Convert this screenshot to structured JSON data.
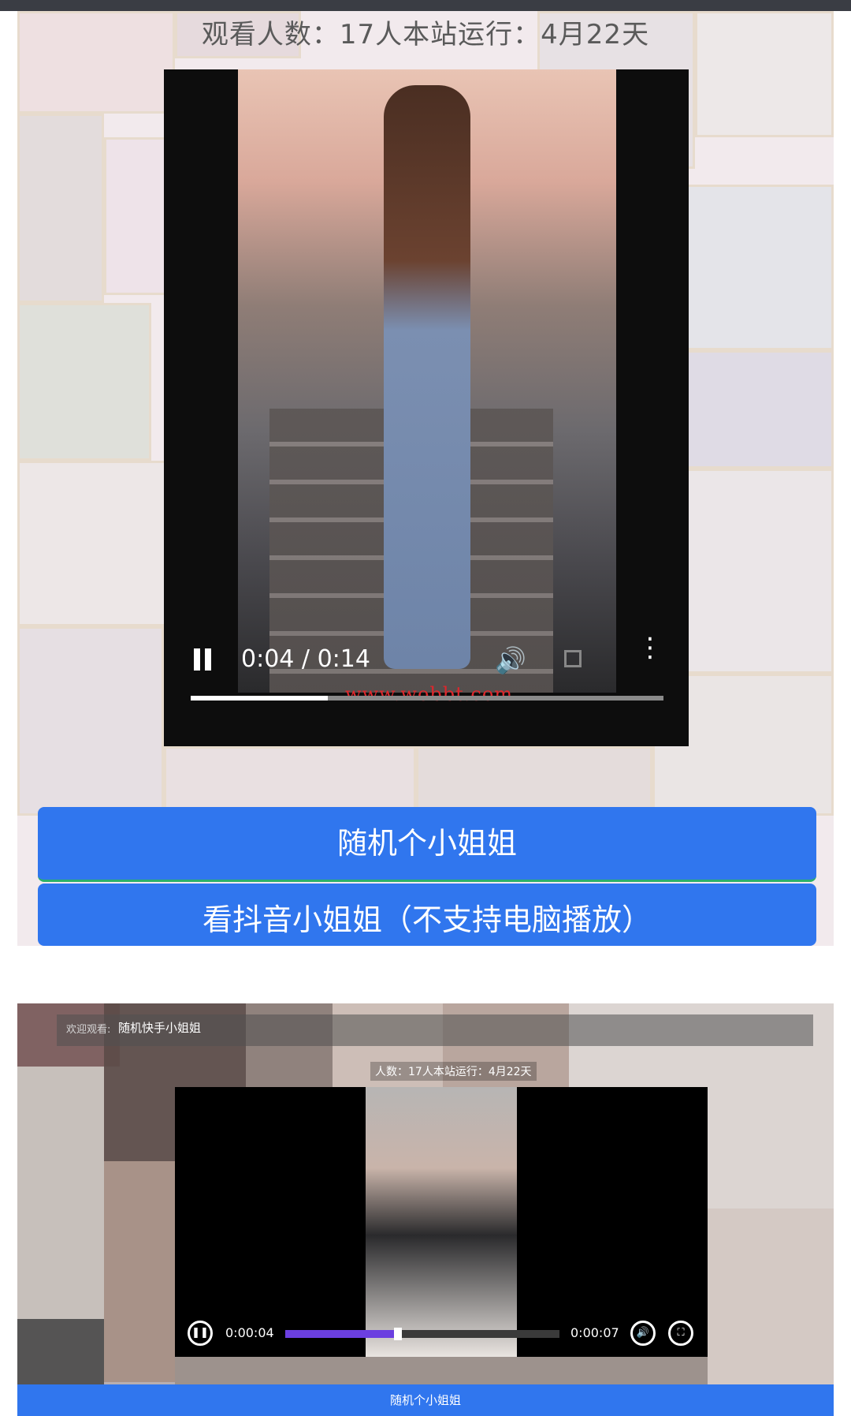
{
  "screen1": {
    "stats": "观看人数：17人本站运行：4月22天",
    "video": {
      "current_time": "0:04",
      "separator": " / ",
      "duration": "0:14",
      "progress": 0.29,
      "watermark": "www.wobbt.com",
      "pause_icon": "pause-icon",
      "volume_icon": "volume-icon",
      "fullscreen_icon": "fullscreen-icon",
      "more_icon": "more-vertical-icon"
    },
    "buttons": [
      {
        "label": "随机个小姐姐"
      },
      {
        "label": "看抖音小姐姐（不支持电脑播放）"
      }
    ]
  },
  "screen2": {
    "welcome": "欢迎观看:",
    "title": "随机快手小姐姐",
    "stats": "人数：17人本站运行：4月22天",
    "video": {
      "current_time": "0:00:04",
      "duration": "0:00:07",
      "progress": 0.41,
      "pause_icon": "pause-icon",
      "volume_icon": "volume-icon",
      "fullscreen_icon": "fullscreen-icon"
    },
    "button_label": "随机个小姐姐"
  },
  "colors": {
    "button_blue": "#3076ee",
    "progress_purple": "#6b3fe0",
    "watermark_red": "#e0262b",
    "topbar": "#3a3d44"
  }
}
